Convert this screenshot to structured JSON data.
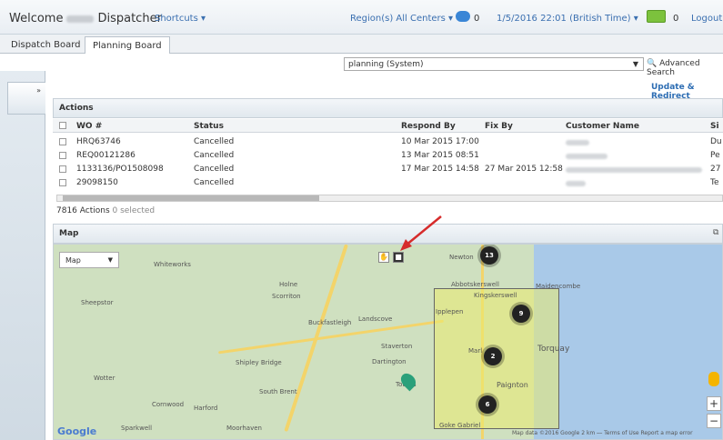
{
  "header": {
    "welcome": "Welcome",
    "role": "Dispatcher",
    "shortcuts": "Shortcuts ▾",
    "region": "Region(s) All Centers ▾",
    "chat_count": "0",
    "datetime": "1/5/2016  22:01 (British Time) ▾",
    "mail_count": "0",
    "logout": "Logout"
  },
  "tabs": [
    "Dispatch Board",
    "Planning Board"
  ],
  "toolbar": {
    "view_select": "planning (System)",
    "advanced_search": "Advanced Search",
    "update_redirect": "Update & Redirect"
  },
  "sidebar": {
    "toggle": "»"
  },
  "actions": {
    "title": "Actions",
    "columns": [
      "WO #",
      "Status",
      "Respond By",
      "Fix By",
      "Customer Name",
      "Si"
    ],
    "rows": [
      {
        "wo": "HRQ63746",
        "status": "Cancelled",
        "respond": "10 Mar 2015 17:00",
        "fix": "",
        "site": "Du"
      },
      {
        "wo": "REQ00121286",
        "status": "Cancelled",
        "respond": "13 Mar 2015 08:51",
        "fix": "",
        "site": "Pe"
      },
      {
        "wo": "1133136/PO1508098",
        "status": "Cancelled",
        "respond": "17 Mar 2015 14:58",
        "fix": "27 Mar 2015 12:58",
        "site": "27"
      },
      {
        "wo": "29098150",
        "status": "Cancelled",
        "respond": "",
        "fix": "",
        "site": "Te"
      }
    ],
    "footer_count": "7816 Actions",
    "footer_selected": "0 selected"
  },
  "map": {
    "title": "Map",
    "type_select": "Map",
    "clusters": [
      "13",
      "9",
      "2",
      "6"
    ],
    "labels": [
      "Whiteworks",
      "Holne",
      "Scorriton",
      "Buckfastleigh",
      "Landscove",
      "Staverton",
      "Dartington",
      "Shipley Bridge",
      "South Brent",
      "Harford",
      "Wotter",
      "Cornwood",
      "Sparkwell",
      "Moorhaven",
      "Sheepstor",
      "Newton",
      "Abbotskerswell",
      "Kingskerswell",
      "Maidencombe",
      "Torquay",
      "Paignton",
      "Marl",
      "Ipplepen",
      "Goke Gabriel",
      "Totnes"
    ],
    "google": "Google",
    "attribution": "Map data ©2016 Google  2 km ⎯⎯   Terms of Use   Report a map error"
  }
}
